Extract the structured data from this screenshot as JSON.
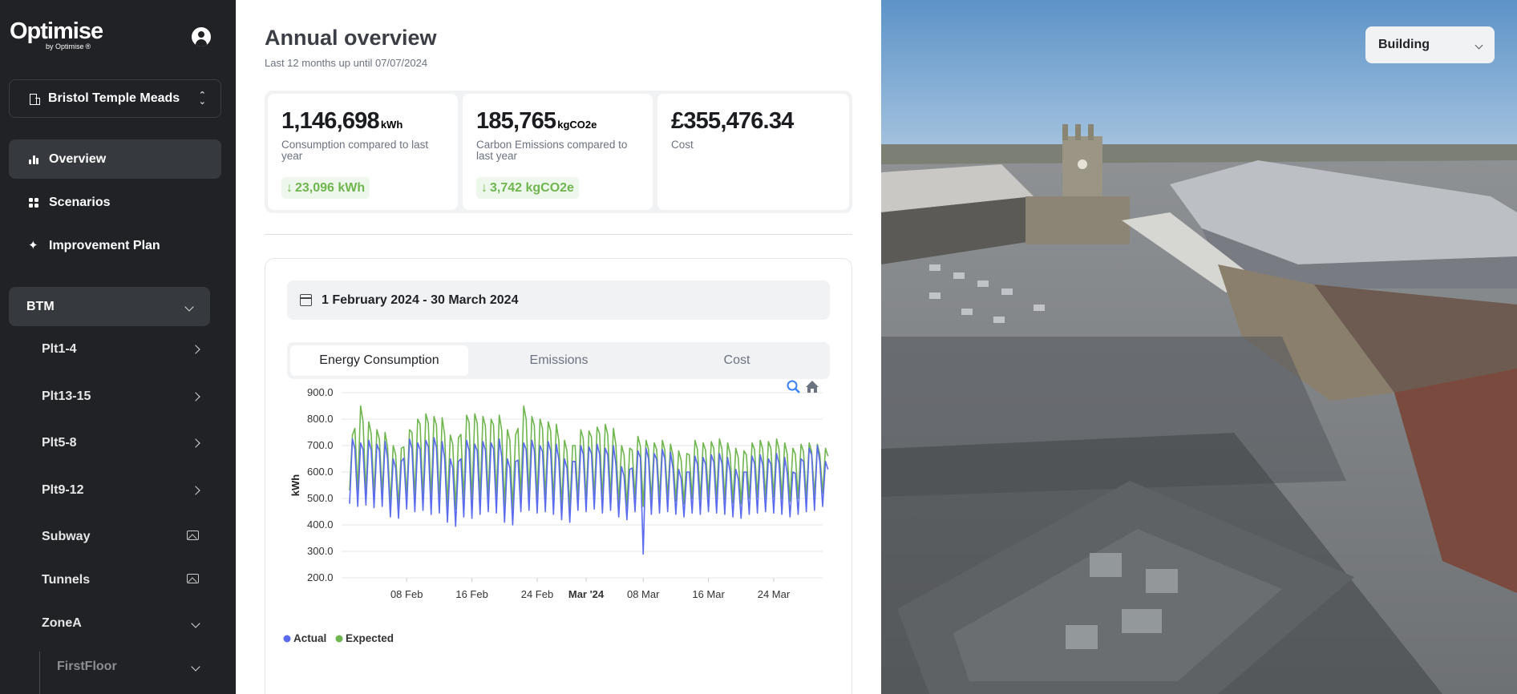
{
  "sidebar": {
    "logo_main": "Optimise",
    "logo_sub": "by Optimise",
    "logo_sub_mark": "®",
    "site": "Bristol Temple Meads",
    "nav": [
      {
        "label": "Overview",
        "icon": "bar-chart-icon",
        "active": true
      },
      {
        "label": "Scenarios",
        "icon": "grid-icon"
      },
      {
        "label": "Improvement Plan",
        "icon": "sparkle-icon"
      }
    ],
    "group": {
      "label": "BTM"
    },
    "children": [
      {
        "label": "Plt1-4",
        "icon": "chevron-right-icon"
      },
      {
        "label": "Plt13-15",
        "icon": "chevron-right-icon"
      },
      {
        "label": "Plt5-8",
        "icon": "chevron-right-icon"
      },
      {
        "label": "Plt9-12",
        "icon": "chevron-right-icon"
      },
      {
        "label": "Subway",
        "icon": "image-icon"
      },
      {
        "label": "Tunnels",
        "icon": "image-icon"
      },
      {
        "label": "ZoneA",
        "icon": "chevron-down-icon"
      }
    ],
    "grandchild": {
      "label": "FirstFloor"
    }
  },
  "overview": {
    "title": "Annual overview",
    "subtitle": "Last 12 months up until 07/07/2024",
    "stats": [
      {
        "value": "1,146,698",
        "unit": "kWh",
        "label": "Consumption compared to last year",
        "delta": "23,096 kWh",
        "direction": "down"
      },
      {
        "value": "185,765",
        "unit": "kgCO2e",
        "label": "Carbon Emissions compared to last year",
        "delta": "3,742 kgCO2e",
        "direction": "down"
      },
      {
        "value": "£355,476.34",
        "unit": "",
        "label": "Cost"
      }
    ],
    "date_range": "1 February 2024 - 30 March 2024",
    "tabs": [
      "Energy Consumption",
      "Emissions",
      "Cost"
    ],
    "active_tab": 0,
    "delta_color": "#6fb64e"
  },
  "building_select": {
    "value": "Building"
  },
  "chart_data": {
    "type": "line",
    "ylabel": "kWh",
    "xlabel": "",
    "ylim": [
      200,
      900
    ],
    "yticks": [
      "900.0",
      "800.0",
      "700.0",
      "600.0",
      "500.0",
      "400.0",
      "300.0",
      "200.0"
    ],
    "xticks": [
      {
        "label": "08 Feb",
        "day": 7,
        "bold": false
      },
      {
        "label": "16 Feb",
        "day": 15,
        "bold": false
      },
      {
        "label": "24 Feb",
        "day": 23,
        "bold": false
      },
      {
        "label": "Mar '24",
        "day": 29,
        "bold": true
      },
      {
        "label": "08 Mar",
        "day": 36,
        "bold": false
      },
      {
        "label": "16 Mar",
        "day": 44,
        "bold": false
      },
      {
        "label": "24 Mar",
        "day": 52,
        "bold": false
      }
    ],
    "x_start": "2024-02-01",
    "x_end": "2024-03-30",
    "series": [
      {
        "name": "Actual",
        "color": "#5b6bef",
        "daily_peaks": [
          725,
          710,
          720,
          705,
          715,
          650,
          640,
          725,
          710,
          720,
          730,
          715,
          650,
          640,
          720,
          705,
          715,
          710,
          725,
          650,
          640,
          710,
          720,
          700,
          715,
          705,
          650,
          640,
          700,
          695,
          705,
          690,
          700,
          620,
          610,
          680,
          690,
          670,
          685,
          675,
          610,
          600,
          660,
          655,
          665,
          670,
          655,
          610,
          600,
          660,
          665,
          650,
          670,
          655,
          600,
          650,
          690,
          700,
          640
        ],
        "daily_lows": [
          480,
          470,
          475,
          465,
          470,
          430,
          425,
          460,
          450,
          455,
          440,
          445,
          410,
          395,
          430,
          425,
          440,
          450,
          445,
          410,
          400,
          450,
          455,
          445,
          450,
          440,
          420,
          410,
          455,
          450,
          460,
          445,
          455,
          430,
          420,
          450,
          290,
          440,
          445,
          450,
          440,
          430,
          445,
          440,
          450,
          445,
          440,
          430,
          425,
          440,
          445,
          450,
          445,
          440,
          430,
          440,
          450,
          455,
          470
        ]
      },
      {
        "name": "Expected",
        "color": "#6fb64e",
        "daily_peaks": [
          740,
          850,
          790,
          760,
          750,
          700,
          690,
          760,
          800,
          820,
          810,
          805,
          740,
          730,
          815,
          820,
          810,
          800,
          815,
          760,
          740,
          850,
          810,
          800,
          790,
          780,
          720,
          700,
          760,
          755,
          770,
          780,
          765,
          700,
          690,
          735,
          720,
          710,
          720,
          705,
          680,
          670,
          720,
          710,
          715,
          725,
          710,
          690,
          680,
          710,
          720,
          715,
          725,
          710,
          690,
          705,
          710,
          705,
          690
        ],
        "daily_lows": [
          530,
          525,
          520,
          515,
          520,
          480,
          470,
          510,
          505,
          495,
          500,
          490,
          470,
          460,
          495,
          490,
          500,
          495,
          505,
          470,
          460,
          500,
          505,
          495,
          500,
          490,
          470,
          460,
          500,
          495,
          505,
          495,
          500,
          480,
          470,
          500,
          470,
          495,
          500,
          505,
          490,
          480,
          500,
          495,
          505,
          500,
          495,
          485,
          480,
          500,
          505,
          500,
          505,
          500,
          490,
          500,
          505,
          510,
          520
        ]
      }
    ],
    "legend": [
      "Actual",
      "Expected"
    ],
    "legend_position": "bottom-left",
    "grid": true,
    "toolbar": [
      "zoom-in-icon",
      "home-icon"
    ]
  }
}
